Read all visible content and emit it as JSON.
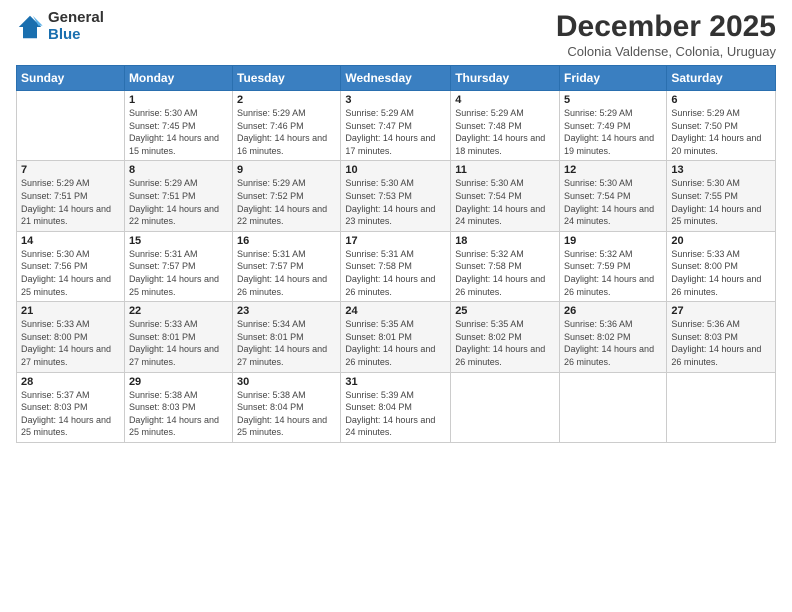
{
  "logo": {
    "general": "General",
    "blue": "Blue"
  },
  "title": {
    "month": "December 2025",
    "location": "Colonia Valdense, Colonia, Uruguay"
  },
  "calendar": {
    "headers": [
      "Sunday",
      "Monday",
      "Tuesday",
      "Wednesday",
      "Thursday",
      "Friday",
      "Saturday"
    ],
    "weeks": [
      [
        {
          "day": "",
          "sunrise": "",
          "sunset": "",
          "daylight": ""
        },
        {
          "day": "1",
          "sunrise": "Sunrise: 5:30 AM",
          "sunset": "Sunset: 7:45 PM",
          "daylight": "Daylight: 14 hours and 15 minutes."
        },
        {
          "day": "2",
          "sunrise": "Sunrise: 5:29 AM",
          "sunset": "Sunset: 7:46 PM",
          "daylight": "Daylight: 14 hours and 16 minutes."
        },
        {
          "day": "3",
          "sunrise": "Sunrise: 5:29 AM",
          "sunset": "Sunset: 7:47 PM",
          "daylight": "Daylight: 14 hours and 17 minutes."
        },
        {
          "day": "4",
          "sunrise": "Sunrise: 5:29 AM",
          "sunset": "Sunset: 7:48 PM",
          "daylight": "Daylight: 14 hours and 18 minutes."
        },
        {
          "day": "5",
          "sunrise": "Sunrise: 5:29 AM",
          "sunset": "Sunset: 7:49 PM",
          "daylight": "Daylight: 14 hours and 19 minutes."
        },
        {
          "day": "6",
          "sunrise": "Sunrise: 5:29 AM",
          "sunset": "Sunset: 7:50 PM",
          "daylight": "Daylight: 14 hours and 20 minutes."
        }
      ],
      [
        {
          "day": "7",
          "sunrise": "Sunrise: 5:29 AM",
          "sunset": "Sunset: 7:51 PM",
          "daylight": "Daylight: 14 hours and 21 minutes."
        },
        {
          "day": "8",
          "sunrise": "Sunrise: 5:29 AM",
          "sunset": "Sunset: 7:51 PM",
          "daylight": "Daylight: 14 hours and 22 minutes."
        },
        {
          "day": "9",
          "sunrise": "Sunrise: 5:29 AM",
          "sunset": "Sunset: 7:52 PM",
          "daylight": "Daylight: 14 hours and 22 minutes."
        },
        {
          "day": "10",
          "sunrise": "Sunrise: 5:30 AM",
          "sunset": "Sunset: 7:53 PM",
          "daylight": "Daylight: 14 hours and 23 minutes."
        },
        {
          "day": "11",
          "sunrise": "Sunrise: 5:30 AM",
          "sunset": "Sunset: 7:54 PM",
          "daylight": "Daylight: 14 hours and 24 minutes."
        },
        {
          "day": "12",
          "sunrise": "Sunrise: 5:30 AM",
          "sunset": "Sunset: 7:54 PM",
          "daylight": "Daylight: 14 hours and 24 minutes."
        },
        {
          "day": "13",
          "sunrise": "Sunrise: 5:30 AM",
          "sunset": "Sunset: 7:55 PM",
          "daylight": "Daylight: 14 hours and 25 minutes."
        }
      ],
      [
        {
          "day": "14",
          "sunrise": "Sunrise: 5:30 AM",
          "sunset": "Sunset: 7:56 PM",
          "daylight": "Daylight: 14 hours and 25 minutes."
        },
        {
          "day": "15",
          "sunrise": "Sunrise: 5:31 AM",
          "sunset": "Sunset: 7:57 PM",
          "daylight": "Daylight: 14 hours and 25 minutes."
        },
        {
          "day": "16",
          "sunrise": "Sunrise: 5:31 AM",
          "sunset": "Sunset: 7:57 PM",
          "daylight": "Daylight: 14 hours and 26 minutes."
        },
        {
          "day": "17",
          "sunrise": "Sunrise: 5:31 AM",
          "sunset": "Sunset: 7:58 PM",
          "daylight": "Daylight: 14 hours and 26 minutes."
        },
        {
          "day": "18",
          "sunrise": "Sunrise: 5:32 AM",
          "sunset": "Sunset: 7:58 PM",
          "daylight": "Daylight: 14 hours and 26 minutes."
        },
        {
          "day": "19",
          "sunrise": "Sunrise: 5:32 AM",
          "sunset": "Sunset: 7:59 PM",
          "daylight": "Daylight: 14 hours and 26 minutes."
        },
        {
          "day": "20",
          "sunrise": "Sunrise: 5:33 AM",
          "sunset": "Sunset: 8:00 PM",
          "daylight": "Daylight: 14 hours and 26 minutes."
        }
      ],
      [
        {
          "day": "21",
          "sunrise": "Sunrise: 5:33 AM",
          "sunset": "Sunset: 8:00 PM",
          "daylight": "Daylight: 14 hours and 27 minutes."
        },
        {
          "day": "22",
          "sunrise": "Sunrise: 5:33 AM",
          "sunset": "Sunset: 8:01 PM",
          "daylight": "Daylight: 14 hours and 27 minutes."
        },
        {
          "day": "23",
          "sunrise": "Sunrise: 5:34 AM",
          "sunset": "Sunset: 8:01 PM",
          "daylight": "Daylight: 14 hours and 27 minutes."
        },
        {
          "day": "24",
          "sunrise": "Sunrise: 5:35 AM",
          "sunset": "Sunset: 8:01 PM",
          "daylight": "Daylight: 14 hours and 26 minutes."
        },
        {
          "day": "25",
          "sunrise": "Sunrise: 5:35 AM",
          "sunset": "Sunset: 8:02 PM",
          "daylight": "Daylight: 14 hours and 26 minutes."
        },
        {
          "day": "26",
          "sunrise": "Sunrise: 5:36 AM",
          "sunset": "Sunset: 8:02 PM",
          "daylight": "Daylight: 14 hours and 26 minutes."
        },
        {
          "day": "27",
          "sunrise": "Sunrise: 5:36 AM",
          "sunset": "Sunset: 8:03 PM",
          "daylight": "Daylight: 14 hours and 26 minutes."
        }
      ],
      [
        {
          "day": "28",
          "sunrise": "Sunrise: 5:37 AM",
          "sunset": "Sunset: 8:03 PM",
          "daylight": "Daylight: 14 hours and 25 minutes."
        },
        {
          "day": "29",
          "sunrise": "Sunrise: 5:38 AM",
          "sunset": "Sunset: 8:03 PM",
          "daylight": "Daylight: 14 hours and 25 minutes."
        },
        {
          "day": "30",
          "sunrise": "Sunrise: 5:38 AM",
          "sunset": "Sunset: 8:04 PM",
          "daylight": "Daylight: 14 hours and 25 minutes."
        },
        {
          "day": "31",
          "sunrise": "Sunrise: 5:39 AM",
          "sunset": "Sunset: 8:04 PM",
          "daylight": "Daylight: 14 hours and 24 minutes."
        },
        {
          "day": "",
          "sunrise": "",
          "sunset": "",
          "daylight": ""
        },
        {
          "day": "",
          "sunrise": "",
          "sunset": "",
          "daylight": ""
        },
        {
          "day": "",
          "sunrise": "",
          "sunset": "",
          "daylight": ""
        }
      ]
    ]
  }
}
